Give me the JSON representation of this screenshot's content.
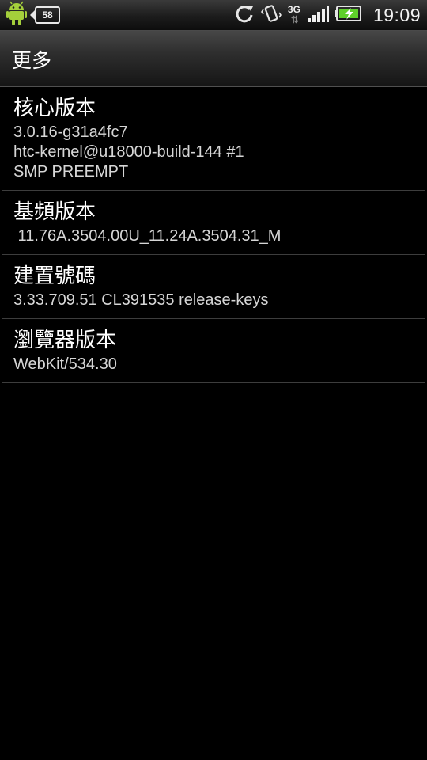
{
  "status_bar": {
    "notification_badge": "58",
    "network_type": "3G",
    "network_arrows": "⇅",
    "time": "19:09",
    "icons": [
      "android-icon",
      "message-badge-icon",
      "sync-icon",
      "vibrate-icon",
      "network-3g-icon",
      "signal-icon",
      "battery-charging-icon"
    ]
  },
  "header": {
    "title": "更多"
  },
  "items": [
    {
      "label": "核心版本",
      "value_lines": [
        "3.0.16-g31a4fc7",
        "htc-kernel@u18000-build-144 #1",
        "SMP PREEMPT"
      ]
    },
    {
      "label": "基頻版本",
      "value_lines": [
        " 11.76A.3504.00U_11.24A.3504.31_M"
      ]
    },
    {
      "label": "建置號碼",
      "value_lines": [
        "3.33.709.51 CL391535 release-keys"
      ]
    },
    {
      "label": "瀏覽器版本",
      "value_lines": [
        "WebKit/534.30"
      ]
    }
  ],
  "colors": {
    "background": "#000000",
    "text_primary": "#ffffff",
    "text_secondary": "#d6d6d6",
    "divider": "#3d3d3d",
    "battery_charge": "#5fd02a",
    "android_green": "#9fcf3a"
  }
}
